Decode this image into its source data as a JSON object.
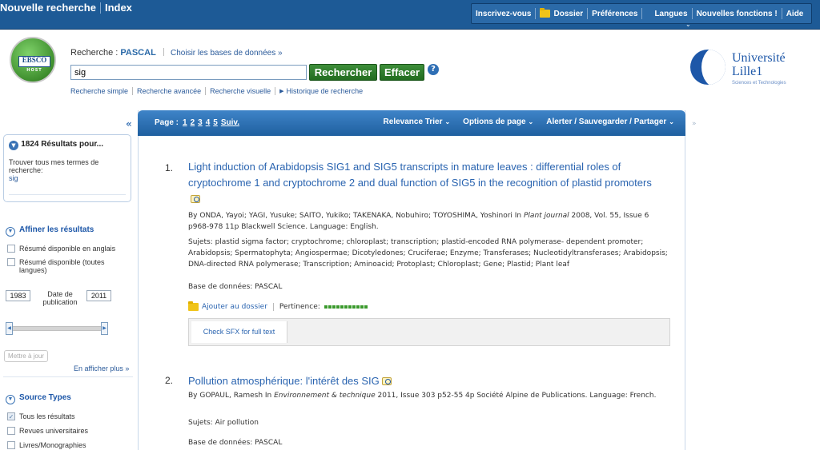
{
  "topbar": {
    "brand_new_search": "Nouvelle recherche",
    "brand_index": "Index",
    "nav": [
      "Inscrivez-vous",
      "Dossier",
      "Préférences",
      "Langues",
      "Nouvelles fonctions !",
      "Aide"
    ]
  },
  "search": {
    "logo_text_top": "EBSCO",
    "logo_text_bottom": "HOST",
    "label_prefix": "Recherche :",
    "database": "PASCAL",
    "choose_db": "Choisir les bases de données »",
    "query": "sig",
    "search_button": "Rechercher",
    "clear_button": "Effacer",
    "help": "?",
    "links": [
      "Recherche simple",
      "Recherche avancée",
      "Recherche visuelle",
      "Historique de recherche"
    ]
  },
  "university": {
    "line1": "Université",
    "line2": "Lille1",
    "line3": "Sciences et Technologies"
  },
  "sidebar": {
    "collapse": "«",
    "results_count": "1824 Résultats pour...",
    "find_all": "Trouver tous mes termes de recherche:",
    "term": "sig",
    "refine_header": "Affiner les résultats",
    "refine_options": [
      "Résumé disponible en anglais",
      "Résumé disponible (toutes langues)"
    ],
    "date_from": "1983",
    "date_label": "Date de publication",
    "date_to": "2011",
    "update_button": "Mettre à jour",
    "show_more": "En afficher plus »",
    "source_header": "Source Types",
    "source_options": [
      {
        "label": "Tous les résultats",
        "checked": true
      },
      {
        "label": "Revues universitaires",
        "checked": false
      },
      {
        "label": "Livres/Monographies",
        "checked": false
      }
    ]
  },
  "results_bar": {
    "page_label": "Page :",
    "pages": [
      "1",
      "2",
      "3",
      "4",
      "5"
    ],
    "next": "Suiv.",
    "sort": "Relevance Trier",
    "page_options": "Options de page",
    "alert": "Alerter / Sauvegarder / Partager"
  },
  "right_col_arrow": "»",
  "results": [
    {
      "num": "1.",
      "title": "Light induction of Arabidopsis SIG1 and SIG5 transcripts in mature leaves : differential roles of cryptochrome 1 and cryptochrome 2 and dual function of SIG5 in the recognition of plastid promoters",
      "by_prefix": "By ONDA, Yayoi; YAGI, Yusuke; SAITO, Yukiko; TAKENAKA, Nobuhiro; TOYOSHIMA, Yoshinori In ",
      "journal": "Plant journal",
      "by_suffix": " 2008, Vol. 55, Issue 6 p968-978 11p Blackwell Science. Language: English.",
      "subjects": "Sujets: plastid sigma factor; cryptochrome; chloroplast; transcription; plastid-encoded RNA polymerase- dependent promoter; Arabidopsis; Spermatophyta; Angiospermae; Dicotyledones; Cruciferae; Enzyme; Transferases; Nucleotidyltransferases; Arabidopsis; DNA-directed RNA polymerase; Transcription; Aminoacid; Protoplast; Chloroplast; Gene; Plastid; Plant leaf",
      "database": "Base de données: PASCAL",
      "add_folder": "Ajouter au dossier",
      "relevance_label": "Pertinence:",
      "sfx": "Check SFX for full text"
    },
    {
      "num": "2.",
      "title": "Pollution atmosphérique: l'intérêt des SIG",
      "by_prefix": "By GOPAUL, Ramesh In ",
      "journal": "Environnement & technique",
      "by_suffix": " 2011, Issue 303 p52-55 4p Société Alpine de Publications. Language: French.",
      "subjects": "Sujets: Air pollution",
      "database": "Base de données: PASCAL"
    }
  ]
}
